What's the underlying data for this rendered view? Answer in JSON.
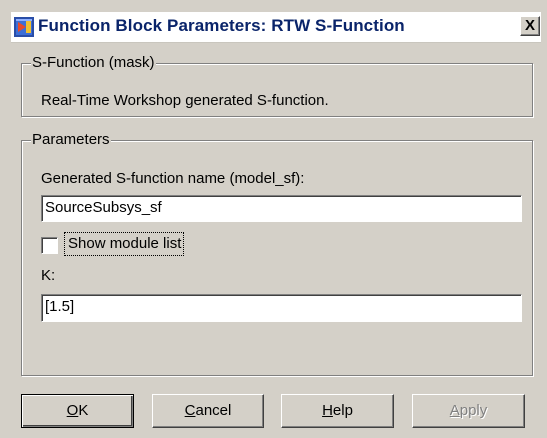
{
  "window": {
    "title": "Function Block Parameters: RTW S-Function",
    "close_glyph": "X",
    "title_color": "#0a246a",
    "icon": "simulink-block-icon"
  },
  "mask_group": {
    "legend": "S-Function (mask)",
    "description": "Real-Time Workshop generated S-function."
  },
  "params_group": {
    "legend": "Parameters",
    "sfunction_name": {
      "label": "Generated S-function name (model_sf):",
      "value": "SourceSubsys_sf"
    },
    "show_module_list": {
      "label": "Show module list",
      "checked": false
    },
    "k": {
      "label": "K:",
      "value": "[1.5]"
    }
  },
  "buttons": {
    "ok": {
      "mnemonic": "O",
      "rest": "K"
    },
    "cancel": {
      "mnemonic": "C",
      "rest": "ancel"
    },
    "help": {
      "mnemonic": "H",
      "rest": "elp"
    },
    "apply": {
      "mnemonic": "A",
      "rest": "pply",
      "disabled": true
    }
  },
  "colors": {
    "dialog_bg": "#d4d0c8",
    "disabled_text": "#808080"
  }
}
